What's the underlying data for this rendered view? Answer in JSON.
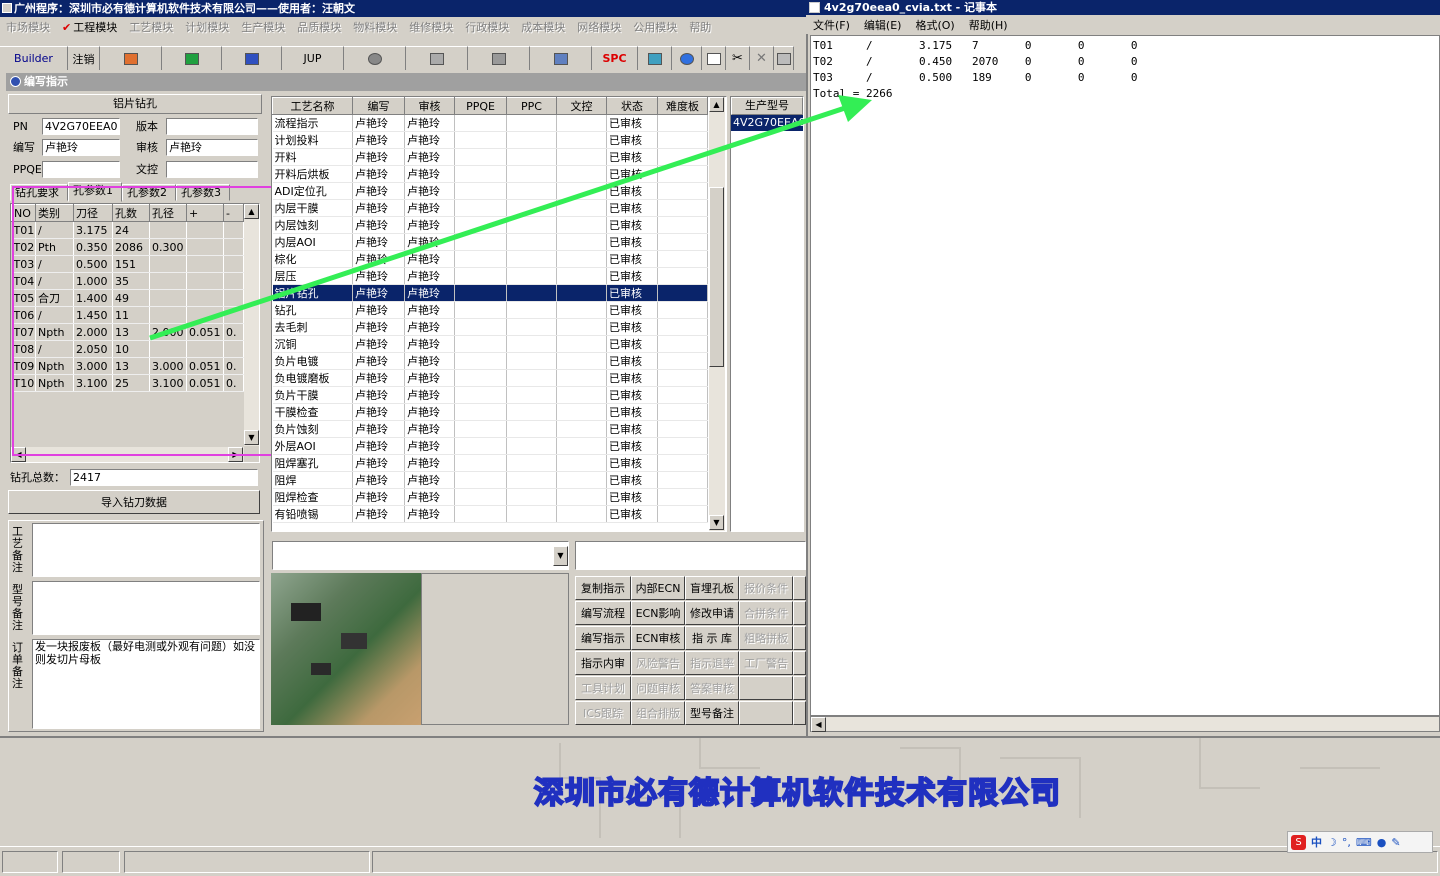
{
  "app": {
    "title": "广州程序：深圳市必有德计算机软件技术有限公司——使用者：汪朝文"
  },
  "menu": [
    "市场模块",
    "工程模块",
    "工艺模块",
    "计划模块",
    "生产模块",
    "品质模块",
    "物料模块",
    "维修模块",
    "行政模块",
    "成本模块",
    "网络模块",
    "公用模块",
    "帮助"
  ],
  "menu_active": "工程模块",
  "toolbar": {
    "builder": "Builder",
    "logout": "注销",
    "jup": "JUP",
    "spc": "SPC"
  },
  "panel": {
    "title": "编写指示"
  },
  "form": {
    "section_title": "铝片钻孔",
    "pn_label": "PN",
    "pn_value": "4V2G70EEA0",
    "version_label": "版本",
    "version_value": "",
    "author_label": "编写",
    "author_value": "卢艳玲",
    "review_label": "审核",
    "review_value": "卢艳玲",
    "ppqe_label": "PPQE",
    "ppqe_value": "",
    "control_label": "文控",
    "control_value": ""
  },
  "tabs": [
    "钻孔要求",
    "孔参数1",
    "孔参数2",
    "孔参数3"
  ],
  "hole_table": {
    "headers": [
      "NO",
      "类别",
      "刀径",
      "孔数",
      "孔径",
      "+",
      "-"
    ],
    "rows": [
      [
        "T01",
        "/",
        "3.175",
        "24",
        "",
        "",
        ""
      ],
      [
        "T02",
        "Pth",
        "0.350",
        "2086",
        "0.300",
        "",
        ""
      ],
      [
        "T03",
        "/",
        "0.500",
        "151",
        "",
        "",
        ""
      ],
      [
        "T04",
        "/",
        "1.000",
        "35",
        "",
        "",
        ""
      ],
      [
        "T05",
        "合刀",
        "1.400",
        "49",
        "",
        "",
        ""
      ],
      [
        "T06",
        "/",
        "1.450",
        "11",
        "",
        "",
        ""
      ],
      [
        "T07",
        "Npth",
        "2.000",
        "13",
        "2.000",
        "0.051",
        "0."
      ],
      [
        "T08",
        "/",
        "2.050",
        "10",
        "",
        "",
        ""
      ],
      [
        "T09",
        "Npth",
        "3.000",
        "13",
        "3.000",
        "0.051",
        "0."
      ],
      [
        "T10",
        "Npth",
        "3.100",
        "25",
        "3.100",
        "0.051",
        "0."
      ]
    ]
  },
  "drill_total": {
    "label": "钻孔总数：",
    "value": "2417"
  },
  "import_button": "导入钻刀数据",
  "notes": {
    "process": "工艺备注",
    "model": "型号备注",
    "order": "订单备注",
    "order_text": "发一块报废板（最好电测或外观有问题）如没则发切片母板"
  },
  "process_table": {
    "headers": [
      "工艺名称",
      "编写",
      "审核",
      "PPQE",
      "PPC",
      "文控",
      "状态",
      "难度板"
    ],
    "rows": [
      [
        "流程指示",
        "卢艳玲",
        "卢艳玲",
        "",
        "",
        "",
        "已审核",
        ""
      ],
      [
        "计划投料",
        "卢艳玲",
        "卢艳玲",
        "",
        "",
        "",
        "已审核",
        ""
      ],
      [
        "开料",
        "卢艳玲",
        "卢艳玲",
        "",
        "",
        "",
        "已审核",
        ""
      ],
      [
        "开料后烘板",
        "卢艳玲",
        "卢艳玲",
        "",
        "",
        "",
        "已审核",
        ""
      ],
      [
        "ADI定位孔",
        "卢艳玲",
        "卢艳玲",
        "",
        "",
        "",
        "已审核",
        ""
      ],
      [
        "内层干膜",
        "卢艳玲",
        "卢艳玲",
        "",
        "",
        "",
        "已审核",
        ""
      ],
      [
        "内层蚀刻",
        "卢艳玲",
        "卢艳玲",
        "",
        "",
        "",
        "已审核",
        ""
      ],
      [
        "内层AOI",
        "卢艳玲",
        "卢艳玲",
        "",
        "",
        "",
        "已审核",
        ""
      ],
      [
        "棕化",
        "卢艳玲",
        "卢艳玲",
        "",
        "",
        "",
        "已审核",
        ""
      ],
      [
        "层压",
        "卢艳玲",
        "卢艳玲",
        "",
        "",
        "",
        "已审核",
        ""
      ],
      [
        "铝片钻孔",
        "卢艳玲",
        "卢艳玲",
        "",
        "",
        "",
        "已审核",
        ""
      ],
      [
        "钻孔",
        "卢艳玲",
        "卢艳玲",
        "",
        "",
        "",
        "已审核",
        ""
      ],
      [
        "去毛刺",
        "卢艳玲",
        "卢艳玲",
        "",
        "",
        "",
        "已审核",
        ""
      ],
      [
        "沉铜",
        "卢艳玲",
        "卢艳玲",
        "",
        "",
        "",
        "已审核",
        ""
      ],
      [
        "负片电镀",
        "卢艳玲",
        "卢艳玲",
        "",
        "",
        "",
        "已审核",
        ""
      ],
      [
        "负电镀磨板",
        "卢艳玲",
        "卢艳玲",
        "",
        "",
        "",
        "已审核",
        ""
      ],
      [
        "负片干膜",
        "卢艳玲",
        "卢艳玲",
        "",
        "",
        "",
        "已审核",
        ""
      ],
      [
        "干膜检查",
        "卢艳玲",
        "卢艳玲",
        "",
        "",
        "",
        "已审核",
        ""
      ],
      [
        "负片蚀刻",
        "卢艳玲",
        "卢艳玲",
        "",
        "",
        "",
        "已审核",
        ""
      ],
      [
        "外层AOI",
        "卢艳玲",
        "卢艳玲",
        "",
        "",
        "",
        "已审核",
        ""
      ],
      [
        "阻焊塞孔",
        "卢艳玲",
        "卢艳玲",
        "",
        "",
        "",
        "已审核",
        ""
      ],
      [
        "阻焊",
        "卢艳玲",
        "卢艳玲",
        "",
        "",
        "",
        "已审核",
        ""
      ],
      [
        "阻焊检查",
        "卢艳玲",
        "卢艳玲",
        "",
        "",
        "",
        "已审核",
        ""
      ],
      [
        "有铅喷锡",
        "卢艳玲",
        "卢艳玲",
        "",
        "",
        "",
        "已审核",
        ""
      ]
    ],
    "selected_index": 10
  },
  "model_list": {
    "header": "生产型号",
    "items": [
      "4V2G70EEA0"
    ]
  },
  "action_buttons": [
    [
      "复制指示",
      "内部ECN",
      "盲埋孔板",
      "报价条件"
    ],
    [
      "编写流程",
      "ECN影响",
      "修改申请",
      "合拼条件"
    ],
    [
      "编写指示",
      "ECN审核",
      "指 示 库",
      "粗略拼板"
    ],
    [
      "指示内审",
      "风险警告",
      "指示退率",
      "工厂警告"
    ],
    [
      "工具计划",
      "问题审核",
      "答案审核",
      ""
    ],
    [
      "ICS跟踪",
      "组合排版",
      "型号备注",
      ""
    ]
  ],
  "disabled_buttons": [
    "报价条件",
    "合拼条件",
    "粗略拼板",
    "工厂警告",
    "工具计划",
    "问题审核",
    "答案审核",
    "ICS跟踪",
    "组合排版",
    "风险警告",
    "指示退率"
  ],
  "company_banner": "深圳市必有德计算机软件技术有限公司",
  "notepad": {
    "title": "4v2g70eea0_cvia.txt - 记事本",
    "menu": [
      "文件(F)",
      "编辑(E)",
      "格式(O)",
      "帮助(H)"
    ],
    "lines": [
      "T01     /       3.175   7       0       0       0",
      "T02     /       0.450   2070    0       0       0",
      "T03     /       0.500   189     0       0       0",
      "Total = 2266"
    ]
  },
  "ime": {
    "label": "中"
  },
  "colors": {
    "title_bar": "#0a246a",
    "selection": "#0a246a",
    "highlight_box": "#e040e0",
    "arrow": "#33ee55",
    "banner_text": "#2030c0"
  }
}
